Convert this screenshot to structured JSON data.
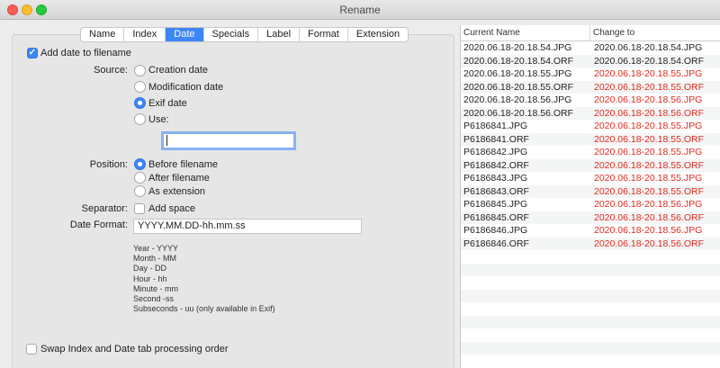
{
  "window": {
    "title": "Rename"
  },
  "tabs": [
    "Name",
    "Index",
    "Date",
    "Specials",
    "Label",
    "Format",
    "Extension"
  ],
  "active_tab": "Date",
  "date_tab": {
    "add_date_label": "Add date to filename",
    "add_date_checked": true,
    "source_label": "Source:",
    "source_options": [
      "Creation date",
      "Modification date",
      "Exif date",
      "Use:"
    ],
    "source_selected": "Exif date",
    "use_value": "",
    "position_label": "Position:",
    "position_options": [
      "Before filename",
      "After filename",
      "As extension"
    ],
    "position_selected": "Before filename",
    "separator_label": "Separator:",
    "add_space_label": "Add space",
    "add_space_checked": false,
    "date_format_label": "Date Format:",
    "date_format_value": "YYYY.MM.DD-hh.mm.ss",
    "legend": [
      "Year - YYYY",
      "Month - MM",
      "Day - DD",
      "Hour - hh",
      "Minute - mm",
      "Second -ss",
      "Subseconds - uu (only available in Exif)"
    ],
    "swap_label": "Swap Index and Date tab processing order",
    "swap_checked": false
  },
  "table": {
    "headers": [
      "Current Name",
      "Change to"
    ],
    "rows": [
      {
        "current": "2020.06.18-20.18.54.JPG",
        "new": "2020.06.18-20.18.54.JPG",
        "changed": false
      },
      {
        "current": "2020.06.18-20.18.54.ORF",
        "new": "2020.06.18-20.18.54.ORF",
        "changed": false
      },
      {
        "current": "2020.06.18-20.18.55.JPG",
        "new": "2020.06.18-20.18.55.JPG",
        "changed": true
      },
      {
        "current": "2020.06.18-20.18.55.ORF",
        "new": "2020.06.18-20.18.55.ORF",
        "changed": true
      },
      {
        "current": "2020.06.18-20.18.56.JPG",
        "new": "2020.06.18-20.18.56.JPG",
        "changed": true
      },
      {
        "current": "2020.06.18-20.18.56.ORF",
        "new": "2020.06.18-20.18.56.ORF",
        "changed": true
      },
      {
        "current": "P6186841.JPG",
        "new": "2020.06.18-20.18.55.JPG",
        "changed": true
      },
      {
        "current": "P6186841.ORF",
        "new": "2020.06.18-20.18.55.ORF",
        "changed": true
      },
      {
        "current": "P6186842.JPG",
        "new": "2020.06.18-20.18.55.JPG",
        "changed": true
      },
      {
        "current": "P6186842.ORF",
        "new": "2020.06.18-20.18.55.ORF",
        "changed": true
      },
      {
        "current": "P6186843.JPG",
        "new": "2020.06.18-20.18.55.JPG",
        "changed": true
      },
      {
        "current": "P6186843.ORF",
        "new": "2020.06.18-20.18.55.ORF",
        "changed": true
      },
      {
        "current": "P6186845.JPG",
        "new": "2020.06.18-20.18.56.JPG",
        "changed": true
      },
      {
        "current": "P6186845.ORF",
        "new": "2020.06.18-20.18.56.ORF",
        "changed": true
      },
      {
        "current": "P6186846.JPG",
        "new": "2020.06.18-20.18.56.JPG",
        "changed": true
      },
      {
        "current": "P6186846.ORF",
        "new": "2020.06.18-20.18.56.ORF",
        "changed": true
      }
    ]
  },
  "colors": {
    "accent": "#3d86f5",
    "changed_text": "#e02a1f"
  }
}
